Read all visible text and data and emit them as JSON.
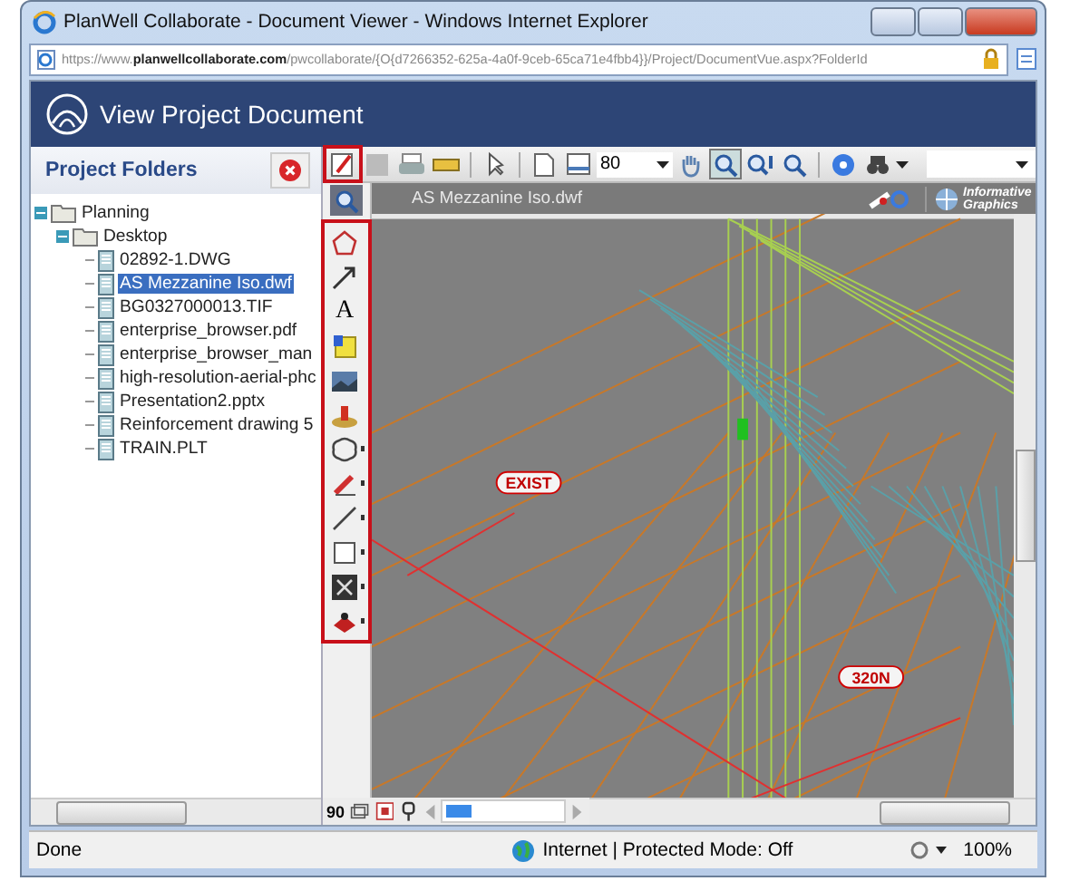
{
  "window": {
    "title": "PlanWell Collaborate - Document Viewer - Windows Internet Explorer"
  },
  "address": {
    "scheme": "https://www.",
    "host": "planwellcollaborate.com",
    "path": "/pwcollaborate/{O{d7266352-625a-4a0f-9ceb-65ca71e4fbb4}}/Project/DocumentVue.aspx?FolderId"
  },
  "app_header": {
    "title": "View Project Document"
  },
  "folders": {
    "title": "Project Folders",
    "tree": [
      {
        "label": "Planning",
        "kind": "folder",
        "expanded": true,
        "selected": false,
        "children": [
          {
            "label": "Desktop",
            "kind": "folder",
            "expanded": true,
            "selected": false,
            "children": [
              {
                "label": "02892-1.DWG",
                "kind": "file",
                "selected": false
              },
              {
                "label": "AS Mezzanine Iso.dwf",
                "kind": "file",
                "selected": true
              },
              {
                "label": "BG0327000013.TIF",
                "kind": "file",
                "selected": false
              },
              {
                "label": "enterprise_browser.pdf",
                "kind": "file",
                "selected": false
              },
              {
                "label": "enterprise_browser_man",
                "kind": "file",
                "selected": false
              },
              {
                "label": "high-resolution-aerial-phc",
                "kind": "file",
                "selected": false
              },
              {
                "label": "Presentation2.pptx",
                "kind": "file",
                "selected": false
              },
              {
                "label": "Reinforcement drawing 5",
                "kind": "file",
                "selected": false
              },
              {
                "label": "TRAIN.PLT",
                "kind": "file",
                "selected": false
              }
            ]
          }
        ]
      }
    ]
  },
  "toolbar": {
    "items": [
      {
        "kind": "markup",
        "highlighted": true,
        "pressed": false
      },
      {
        "kind": "save",
        "highlighted": false,
        "pressed": false
      },
      {
        "kind": "print",
        "highlighted": false,
        "pressed": false
      },
      {
        "kind": "ruler",
        "highlighted": false,
        "pressed": false
      },
      {
        "kind": "sep"
      },
      {
        "kind": "pointer",
        "highlighted": false,
        "pressed": false
      },
      {
        "kind": "sep"
      },
      {
        "kind": "page",
        "highlighted": false,
        "pressed": false
      },
      {
        "kind": "pages",
        "highlighted": false,
        "pressed": false
      },
      {
        "kind": "zoom-select",
        "value": "80"
      },
      {
        "kind": "hand",
        "highlighted": false,
        "pressed": false
      },
      {
        "kind": "zoom-window",
        "highlighted": false,
        "pressed": true
      },
      {
        "kind": "zoom-fit",
        "highlighted": false,
        "pressed": false
      },
      {
        "kind": "zoom",
        "highlighted": false,
        "pressed": false
      },
      {
        "kind": "sep"
      },
      {
        "kind": "help",
        "highlighted": false,
        "pressed": false
      },
      {
        "kind": "binoculars",
        "highlighted": false,
        "pressed": false
      },
      {
        "kind": "search-select"
      }
    ]
  },
  "document": {
    "title": "AS Mezzanine Iso.dwf",
    "logo": "Informative Graphics",
    "labels": [
      "EXIST",
      "320N"
    ]
  },
  "tools": {
    "highlighted": true,
    "items": [
      {
        "kind": "polygon",
        "has_menu": false
      },
      {
        "kind": "arrow",
        "has_menu": false
      },
      {
        "kind": "text",
        "label": "A",
        "has_menu": false
      },
      {
        "kind": "note",
        "has_menu": false
      },
      {
        "kind": "image",
        "has_menu": false
      },
      {
        "kind": "stamp",
        "has_menu": false
      },
      {
        "kind": "cloud",
        "has_menu": true
      },
      {
        "kind": "pen",
        "has_menu": true
      },
      {
        "kind": "line",
        "has_menu": true
      },
      {
        "kind": "rect",
        "has_menu": true
      },
      {
        "kind": "crossbox",
        "has_menu": true
      },
      {
        "kind": "redact",
        "has_menu": true
      }
    ]
  },
  "bottom_bar": {
    "rotate": "90"
  },
  "status_bar": {
    "text": "Done",
    "zone": "Internet | Protected Mode: Off",
    "zoom": "100%"
  }
}
